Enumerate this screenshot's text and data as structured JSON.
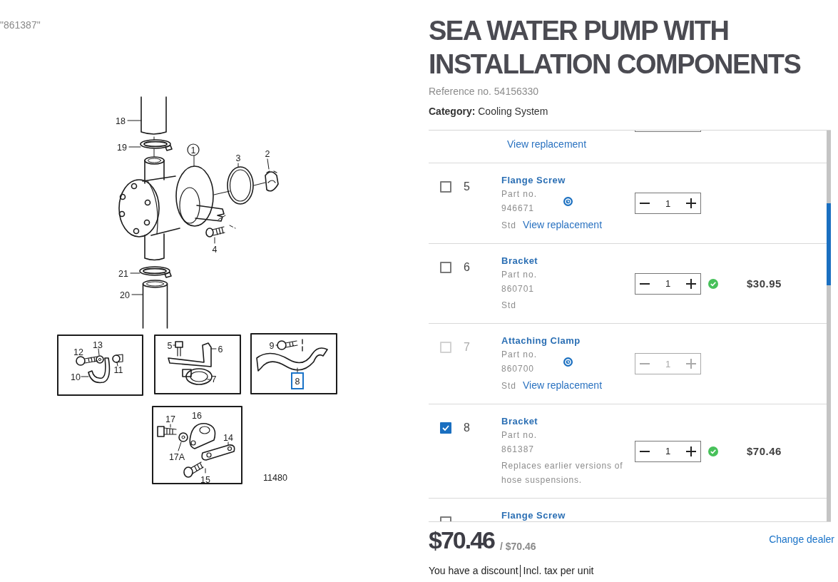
{
  "search_term": "\"861387\"",
  "diagram": {
    "callouts": [
      {
        "label": "18",
        "kind": "plain",
        "selected": false
      },
      {
        "label": "19",
        "kind": "plain",
        "selected": false
      },
      {
        "label": "1",
        "kind": "circled",
        "selected": false
      },
      {
        "label": "3",
        "kind": "plain",
        "selected": false
      },
      {
        "label": "2",
        "kind": "plain",
        "selected": false
      },
      {
        "label": "4",
        "kind": "plain",
        "selected": false
      },
      {
        "label": "21",
        "kind": "plain",
        "selected": false
      },
      {
        "label": "20",
        "kind": "plain",
        "selected": false
      },
      {
        "label": "12",
        "kind": "plain",
        "selected": false
      },
      {
        "label": "13",
        "kind": "plain",
        "selected": false
      },
      {
        "label": "11",
        "kind": "plain",
        "selected": false
      },
      {
        "label": "10",
        "kind": "plain",
        "selected": false
      },
      {
        "label": "5",
        "kind": "plain",
        "selected": false
      },
      {
        "label": "6",
        "kind": "plain",
        "selected": false
      },
      {
        "label": "7",
        "kind": "plain",
        "selected": false
      },
      {
        "label": "9",
        "kind": "plain",
        "selected": false
      },
      {
        "label": "8",
        "kind": "plain",
        "selected": true
      },
      {
        "label": "17",
        "kind": "plain",
        "selected": false
      },
      {
        "label": "16",
        "kind": "plain",
        "selected": false
      },
      {
        "label": "14",
        "kind": "plain",
        "selected": false
      },
      {
        "label": "17A",
        "kind": "plain",
        "selected": false
      },
      {
        "label": "15",
        "kind": "plain",
        "selected": false
      }
    ],
    "figure_number": "11480"
  },
  "product": {
    "title": "SEA WATER PUMP WITH INSTALLATION COMPONENTS",
    "reference": "Reference no. 54156330",
    "category": "**Category:** Cooling System"
  },
  "parts": [
    {
      "kind": "tail",
      "replacement_link": "View replacement"
    },
    {
      "kind": "item",
      "checked": false,
      "disabled": false,
      "number": "5",
      "name": "Flange Screw",
      "part_no_label": "Part no.",
      "part_no": "946671",
      "replaced": true,
      "grade": "Std",
      "replacement_link": "View replacement",
      "quantity": "1",
      "available": false
    },
    {
      "kind": "item",
      "checked": false,
      "disabled": false,
      "number": "6",
      "name": "Bracket",
      "part_no_label": "Part no.",
      "part_no": "860701",
      "replaced": false,
      "grade": "Std",
      "quantity": "1",
      "available": true,
      "price": "$30.95"
    },
    {
      "kind": "item",
      "checked": false,
      "disabled": true,
      "number": "7",
      "name": "Attaching Clamp",
      "part_no_label": "Part no.",
      "part_no": "860700",
      "replaced": true,
      "grade": "Std",
      "replacement_link": "View replacement",
      "quantity": "1",
      "available": false
    },
    {
      "kind": "item",
      "checked": true,
      "disabled": false,
      "number": "8",
      "name": "Bracket",
      "part_no_label": "Part no.",
      "part_no": "861387",
      "replaced": false,
      "note": "Replaces earlier versions of hose suspensions.",
      "quantity": "1",
      "available": true,
      "price": "$70.46"
    },
    {
      "kind": "head",
      "checked": false,
      "name": "Flange Screw"
    }
  ],
  "footer": {
    "price": "$70.46",
    "unit_price": "/ $70.46",
    "change_dealer": "Change dealer",
    "discount": "You have a discount",
    "tax_note": "Incl. tax per unit"
  }
}
